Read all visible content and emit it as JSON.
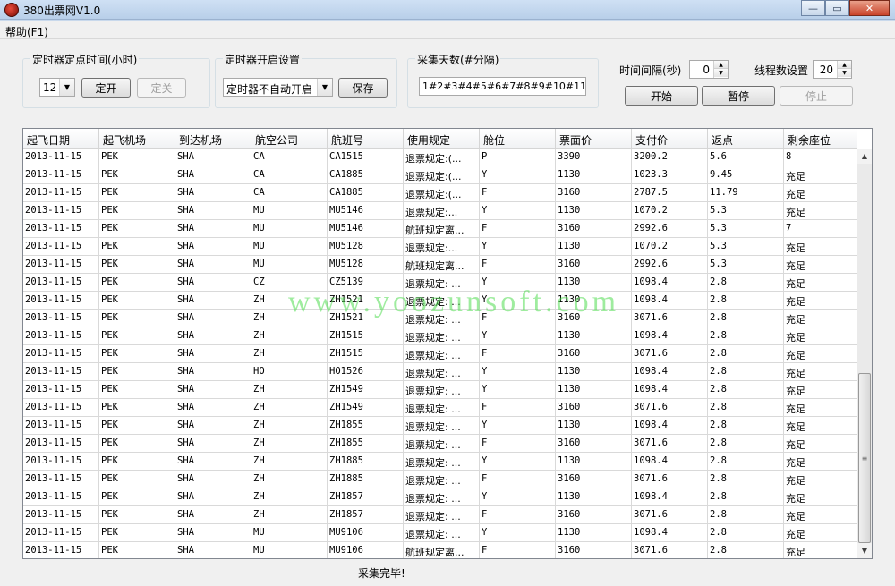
{
  "window": {
    "title": "380出票网V1.0",
    "min": "—",
    "max": "▭",
    "close": "✕"
  },
  "menu": {
    "help": "帮助(F1)"
  },
  "timer_point": {
    "label": "定时器定点时间(小时)",
    "hour": "12",
    "start_btn": "定开",
    "stop_btn": "定关"
  },
  "timer_setting": {
    "label": "定时器开启设置",
    "mode": "定时器不自动开启",
    "save_btn": "保存"
  },
  "collect_days": {
    "label": "采集天数(#分隔)",
    "value": "1#2#3#4#5#6#7#8#9#10#11#12#13"
  },
  "interval": {
    "label": "时间间隔(秒)",
    "value": "0"
  },
  "threads": {
    "label": "线程数设置",
    "value": "20"
  },
  "controls": {
    "start": "开始",
    "pause": "暂停",
    "stop": "停止"
  },
  "table": {
    "columns": [
      "起飞日期",
      "起飞机场",
      "到达机场",
      "航空公司",
      "航班号",
      "使用规定",
      "舱位",
      "票面价",
      "支付价",
      "返点",
      "剩余座位"
    ],
    "rows": [
      [
        "2013-11-15",
        "PEK",
        "SHA",
        "CA",
        "CA1515",
        "退票规定:(...",
        "P",
        "3390",
        "3200.2",
        "5.6",
        "8"
      ],
      [
        "2013-11-15",
        "PEK",
        "SHA",
        "CA",
        "CA1885",
        "退票规定:(...",
        "Y",
        "1130",
        "1023.3",
        "9.45",
        "充足"
      ],
      [
        "2013-11-15",
        "PEK",
        "SHA",
        "CA",
        "CA1885",
        "退票规定:(...",
        "F",
        "3160",
        "2787.5",
        "11.79",
        "充足"
      ],
      [
        "2013-11-15",
        "PEK",
        "SHA",
        "MU",
        "MU5146",
        "退票规定:...",
        "Y",
        "1130",
        "1070.2",
        "5.3",
        "充足"
      ],
      [
        "2013-11-15",
        "PEK",
        "SHA",
        "MU",
        "MU5146",
        "航班规定离...",
        "F",
        "3160",
        "2992.6",
        "5.3",
        "7"
      ],
      [
        "2013-11-15",
        "PEK",
        "SHA",
        "MU",
        "MU5128",
        "退票规定:...",
        "Y",
        "1130",
        "1070.2",
        "5.3",
        "充足"
      ],
      [
        "2013-11-15",
        "PEK",
        "SHA",
        "MU",
        "MU5128",
        "航班规定离...",
        "F",
        "3160",
        "2992.6",
        "5.3",
        "充足"
      ],
      [
        "2013-11-15",
        "PEK",
        "SHA",
        "CZ",
        "CZ5139",
        "退票规定: ...",
        "Y",
        "1130",
        "1098.4",
        "2.8",
        "充足"
      ],
      [
        "2013-11-15",
        "PEK",
        "SHA",
        "ZH",
        "ZH1521",
        "退票规定: ...",
        "Y",
        "1130",
        "1098.4",
        "2.8",
        "充足"
      ],
      [
        "2013-11-15",
        "PEK",
        "SHA",
        "ZH",
        "ZH1521",
        "退票规定: ...",
        "F",
        "3160",
        "3071.6",
        "2.8",
        "充足"
      ],
      [
        "2013-11-15",
        "PEK",
        "SHA",
        "ZH",
        "ZH1515",
        "退票规定: ...",
        "Y",
        "1130",
        "1098.4",
        "2.8",
        "充足"
      ],
      [
        "2013-11-15",
        "PEK",
        "SHA",
        "ZH",
        "ZH1515",
        "退票规定: ...",
        "F",
        "3160",
        "3071.6",
        "2.8",
        "充足"
      ],
      [
        "2013-11-15",
        "PEK",
        "SHA",
        "HO",
        "HO1526",
        "退票规定: ...",
        "Y",
        "1130",
        "1098.4",
        "2.8",
        "充足"
      ],
      [
        "2013-11-15",
        "PEK",
        "SHA",
        "ZH",
        "ZH1549",
        "退票规定: ...",
        "Y",
        "1130",
        "1098.4",
        "2.8",
        "充足"
      ],
      [
        "2013-11-15",
        "PEK",
        "SHA",
        "ZH",
        "ZH1549",
        "退票规定: ...",
        "F",
        "3160",
        "3071.6",
        "2.8",
        "充足"
      ],
      [
        "2013-11-15",
        "PEK",
        "SHA",
        "ZH",
        "ZH1855",
        "退票规定: ...",
        "Y",
        "1130",
        "1098.4",
        "2.8",
        "充足"
      ],
      [
        "2013-11-15",
        "PEK",
        "SHA",
        "ZH",
        "ZH1855",
        "退票规定: ...",
        "F",
        "3160",
        "3071.6",
        "2.8",
        "充足"
      ],
      [
        "2013-11-15",
        "PEK",
        "SHA",
        "ZH",
        "ZH1885",
        "退票规定: ...",
        "Y",
        "1130",
        "1098.4",
        "2.8",
        "充足"
      ],
      [
        "2013-11-15",
        "PEK",
        "SHA",
        "ZH",
        "ZH1885",
        "退票规定: ...",
        "F",
        "3160",
        "3071.6",
        "2.8",
        "充足"
      ],
      [
        "2013-11-15",
        "PEK",
        "SHA",
        "ZH",
        "ZH1857",
        "退票规定: ...",
        "Y",
        "1130",
        "1098.4",
        "2.8",
        "充足"
      ],
      [
        "2013-11-15",
        "PEK",
        "SHA",
        "ZH",
        "ZH1857",
        "退票规定: ...",
        "F",
        "3160",
        "3071.6",
        "2.8",
        "充足"
      ],
      [
        "2013-11-15",
        "PEK",
        "SHA",
        "MU",
        "MU9106",
        "退票规定: ...",
        "Y",
        "1130",
        "1098.4",
        "2.8",
        "充足"
      ],
      [
        "2013-11-15",
        "PEK",
        "SHA",
        "MU",
        "MU9106",
        "航班规定离...",
        "F",
        "3160",
        "3071.6",
        "2.8",
        "充足"
      ]
    ]
  },
  "watermark": "www.yoozunsoft.com",
  "status": "采集完毕!"
}
